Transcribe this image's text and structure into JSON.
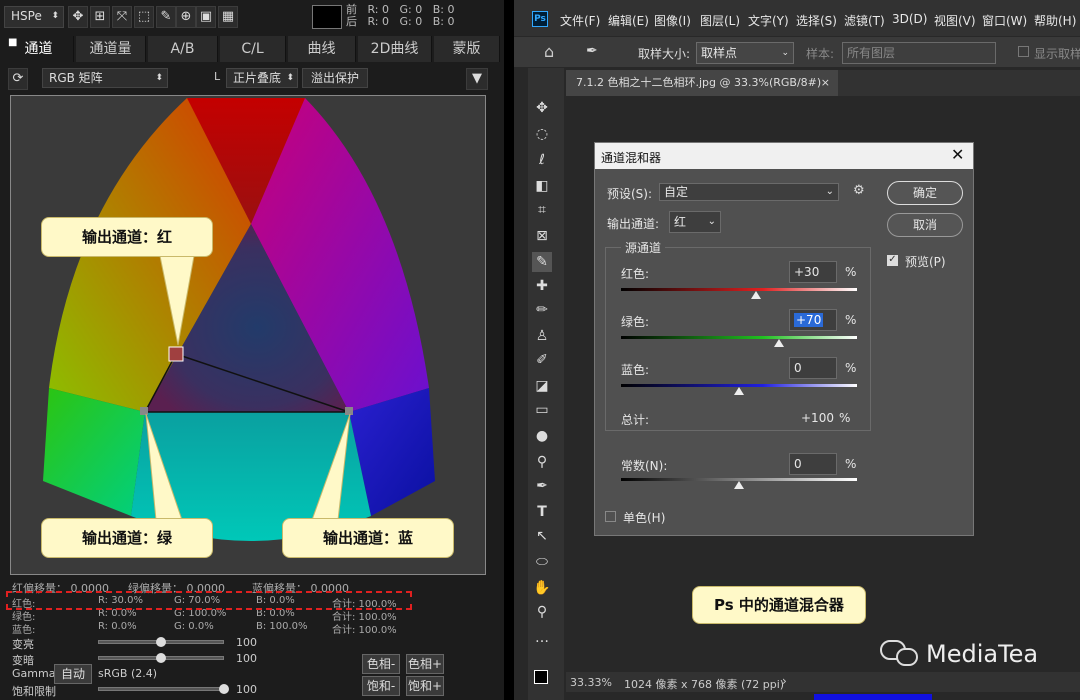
{
  "left": {
    "mode_select": "HSPe",
    "readout": {
      "label_front": "前",
      "label_back": "后",
      "r1": "R:  0",
      "g1": "G:  0",
      "b1": "B:  0",
      "r2": "R:  0",
      "g2": "G:  0",
      "b2": "B:  0"
    },
    "tabs": [
      "通道",
      "通道量",
      "A/B",
      "C/L",
      "曲线",
      "2D曲线",
      "蒙版"
    ],
    "matrix_select": "RGB 矩阵",
    "blend_label": "L",
    "blend_select": "正片叠底",
    "overflow_button": "溢出保护",
    "callouts": {
      "red": "输出通道：红",
      "green": "输出通道：绿",
      "blue": "输出通道：蓝"
    },
    "offsets": {
      "red": "红偏移量：  0.0000",
      "green": "绿偏移量：  0.0000",
      "blue": "蓝偏移量：  0.0000"
    },
    "rows": [
      {
        "name": "红色:",
        "r": "R: 30.0%",
        "g": "G: 70.0%",
        "b": "B: 0.0%",
        "total": "合计: 100.0%"
      },
      {
        "name": "绿色:",
        "r": "R: 0.0%",
        "g": "G: 100.0%",
        "b": "B: 0.0%",
        "total": "合计: 100.0%"
      },
      {
        "name": "蓝色:",
        "r": "R: 0.0%",
        "g": "G: 0.0%",
        "b": "B: 100.0%",
        "total": "合计: 100.0%"
      }
    ],
    "sliders": [
      {
        "label": "变亮",
        "value": "100",
        "pos": 0.5
      },
      {
        "label": "变暗",
        "value": "100",
        "pos": 0.5
      },
      {
        "label": "饱和限制",
        "value": "100",
        "pos": 1.0
      }
    ],
    "gamma_label": "Gamma",
    "auto_button": "自动",
    "gamma_value": "sRGB (2.4)",
    "buttons": {
      "hue_minus": "色相-",
      "hue_plus": "色相+",
      "sat_minus": "饱和-",
      "sat_plus": "饱和+"
    }
  },
  "ps": {
    "logo": "Ps",
    "menu": [
      "文件(F)",
      "编辑(E)",
      "图像(I)",
      "图层(L)",
      "文字(Y)",
      "选择(S)",
      "滤镜(T)",
      "3D(D)",
      "视图(V)",
      "窗口(W)",
      "帮助(H)"
    ],
    "options": {
      "sample_label": "取样大小:",
      "sample_value": "取样点",
      "layer_label": "样本:",
      "layer_value": "所有图层",
      "show_ring": "显示取样"
    },
    "doc_tab": "7.1.2 色相之十二色相环.jpg @ 33.3%(RGB/8#)",
    "status": {
      "zoom": "33.33%",
      "size": "1024 像素 x 768 像素 (72 ppi)"
    },
    "caption": "Ps 中的通道混合器",
    "watermark": "MediaTea"
  },
  "dialog": {
    "title": "通道混和器",
    "preset_label": "预设(S):",
    "preset_value": "自定",
    "output_label": "输出通道:",
    "output_value": "红",
    "source_group": "源通道",
    "channels": [
      {
        "label": "红色:",
        "value": "+30",
        "pct": "%",
        "pos": 0.57
      },
      {
        "label": "绿色:",
        "value": "+70",
        "pct": "%",
        "pos": 0.67
      },
      {
        "label": "蓝色:",
        "value": "0",
        "pct": "%",
        "pos": 0.5
      }
    ],
    "total_label": "总计:",
    "total_value": "+100",
    "total_pct": "%",
    "constant_label": "常数(N):",
    "constant_value": "0",
    "constant_pct": "%",
    "constant_pos": 0.5,
    "mono_label": "单色(H)",
    "ok": "确定",
    "cancel": "取消",
    "preview": "预览(P)"
  }
}
